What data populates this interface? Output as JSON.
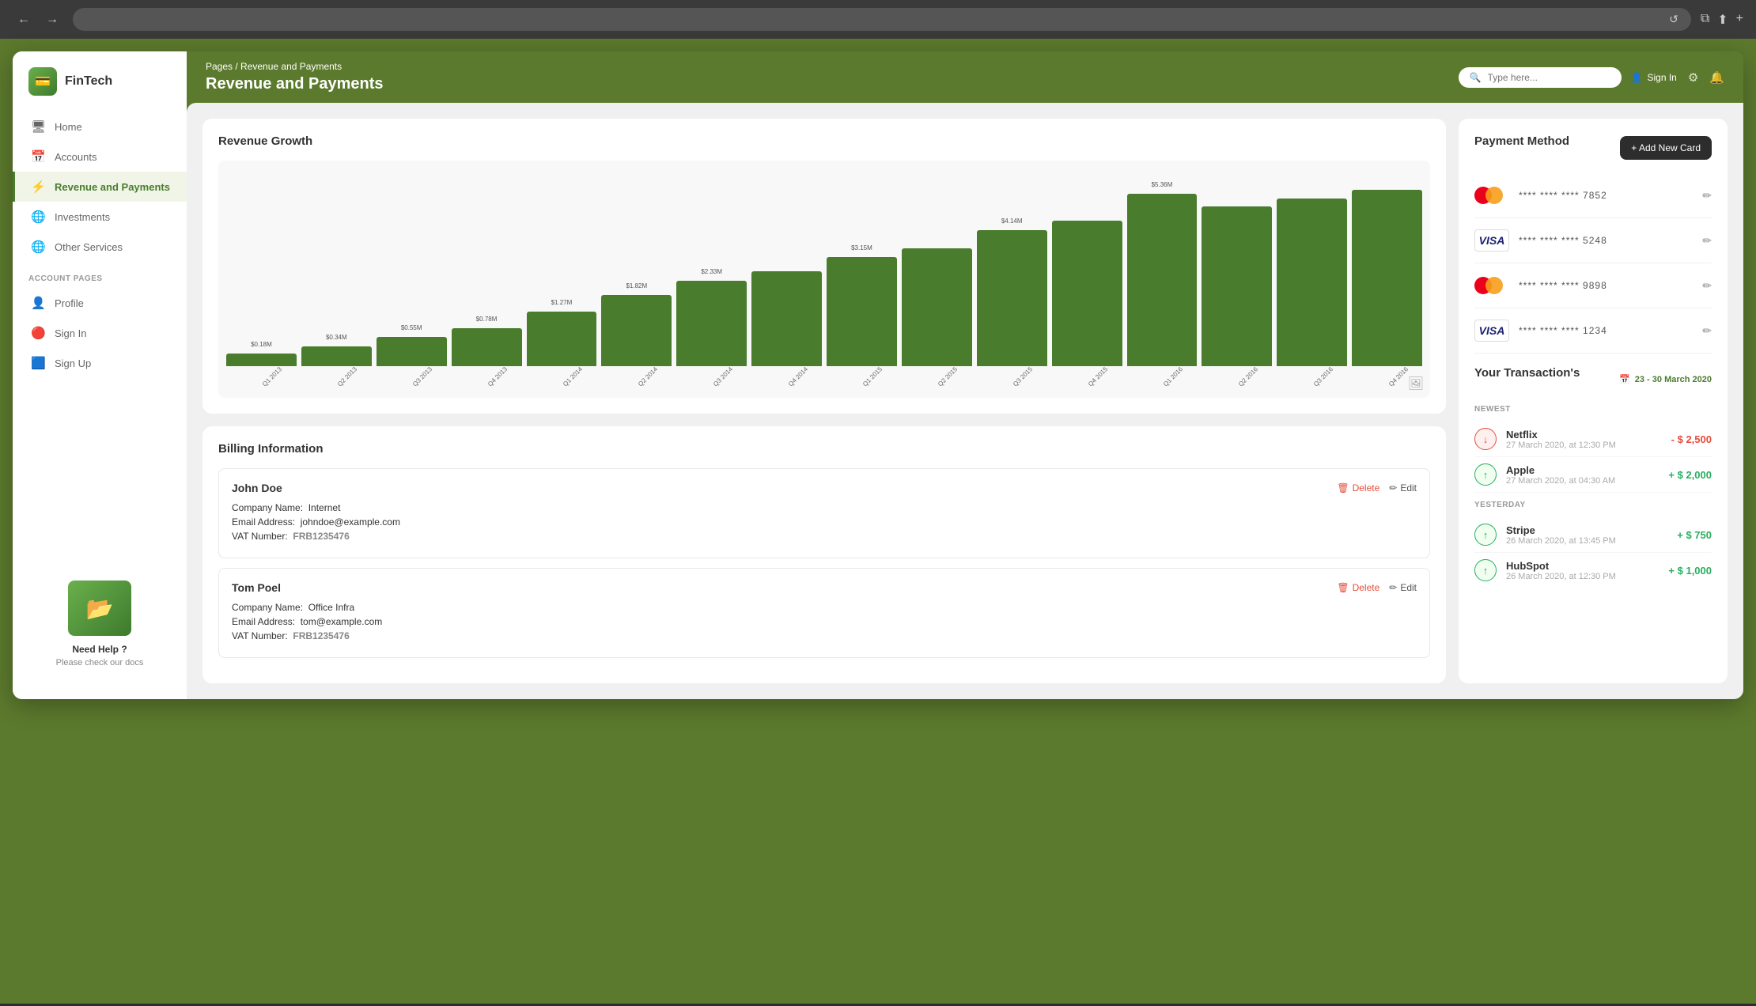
{
  "browser": {
    "back_label": "←",
    "forward_label": "→",
    "reload_label": "↺",
    "address_placeholder": "",
    "action_labels": [
      "⧉",
      "⬆",
      "+"
    ]
  },
  "sidebar": {
    "logo_text": "FinTech",
    "nav_items": [
      {
        "id": "home",
        "label": "Home",
        "icon": "🖥",
        "active": false
      },
      {
        "id": "accounts",
        "label": "Accounts",
        "icon": "📅",
        "active": false
      },
      {
        "id": "revenue",
        "label": "Revenue and Payments",
        "icon": "⚡",
        "active": true
      },
      {
        "id": "investments",
        "label": "Investments",
        "icon": "🌐",
        "active": false
      },
      {
        "id": "other",
        "label": "Other Services",
        "icon": "🌐",
        "active": false
      }
    ],
    "account_section_label": "ACCOUNT PAGES",
    "account_items": [
      {
        "id": "profile",
        "label": "Profile",
        "icon": "👤",
        "active": false
      },
      {
        "id": "signin",
        "label": "Sign In",
        "icon": "🔴",
        "active": false
      },
      {
        "id": "signup",
        "label": "Sign Up",
        "icon": "🟦",
        "active": false
      }
    ],
    "help": {
      "title": "Need Help ?",
      "subtitle": "Please check our docs"
    }
  },
  "header": {
    "breadcrumb_pages": "Pages",
    "breadcrumb_separator": "/",
    "breadcrumb_current": "Revenue and Payments",
    "page_title": "Revenue and Payments",
    "search_placeholder": "Type here...",
    "sign_in_label": "Sign In",
    "settings_icon": "⚙",
    "notifications_icon": "🔔"
  },
  "revenue_chart": {
    "title": "Revenue Growth",
    "bars": [
      {
        "label": "Q1 2013",
        "value": "$0.18M",
        "height_pct": 7
      },
      {
        "label": "Q2 2013",
        "value": "$0.34M",
        "height_pct": 11
      },
      {
        "label": "Q3 2013",
        "value": "$0.55M",
        "height_pct": 16
      },
      {
        "label": "Q4 2013",
        "value": "$0.78M",
        "height_pct": 21
      },
      {
        "label": "Q1 2014",
        "value": "$1.27M",
        "height_pct": 30
      },
      {
        "label": "Q2 2014",
        "value": "$1.82M",
        "height_pct": 39
      },
      {
        "label": "Q3 2014",
        "value": "$2.33M",
        "height_pct": 47
      },
      {
        "label": "Q4 2014",
        "value": "",
        "height_pct": 52
      },
      {
        "label": "Q1 2015",
        "value": "$3.15M",
        "height_pct": 60
      },
      {
        "label": "Q2 2015",
        "value": "",
        "height_pct": 65
      },
      {
        "label": "Q3 2015",
        "value": "$4.14M",
        "height_pct": 75
      },
      {
        "label": "Q4 2015",
        "value": "",
        "height_pct": 80
      },
      {
        "label": "Q1 2016",
        "value": "$5.36M",
        "height_pct": 95
      },
      {
        "label": "Q2 2016",
        "value": "",
        "height_pct": 88
      },
      {
        "label": "Q3 2016",
        "value": "",
        "height_pct": 92
      },
      {
        "label": "Q4 2016",
        "value": "",
        "height_pct": 97
      }
    ]
  },
  "payment_method": {
    "title": "Payment Method",
    "add_button_label": "+ Add New Card",
    "cards": [
      {
        "type": "mastercard",
        "number": "**** **** **** 7852"
      },
      {
        "type": "visa",
        "number": "**** **** **** 5248"
      },
      {
        "type": "mastercard",
        "number": "**** **** **** 9898"
      },
      {
        "type": "visa",
        "number": "**** **** **** 1234"
      }
    ]
  },
  "billing": {
    "title": "Billing Information",
    "entries": [
      {
        "name": "John Doe",
        "company_label": "Company Name:",
        "company": "Internet",
        "email_label": "Email Address:",
        "email": "johndoe@example.com",
        "vat_label": "VAT Number:",
        "vat": "FRB1235476"
      },
      {
        "name": "Tom Poel",
        "company_label": "Company Name:",
        "company": "Office Infra",
        "email_label": "Email Address:",
        "email": "tom@example.com",
        "vat_label": "VAT Number:",
        "vat": "FRB1235476"
      }
    ],
    "delete_label": "Delete",
    "edit_label": "Edit"
  },
  "transactions": {
    "title": "Your Transaction's",
    "date_range": "23 - 30 March 2020",
    "newest_label": "NEWEST",
    "yesterday_label": "YESTERDAY",
    "items": [
      {
        "name": "Netflix",
        "date": "27 March 2020, at 12:30 PM",
        "amount": "- $ 2,500",
        "direction": "down",
        "section": "newest"
      },
      {
        "name": "Apple",
        "date": "27 March 2020, at 04:30 AM",
        "amount": "+ $ 2,000",
        "direction": "up",
        "section": "newest"
      },
      {
        "name": "Stripe",
        "date": "26 March 2020, at 13:45 PM",
        "amount": "+ $ 750",
        "direction": "up",
        "section": "yesterday"
      },
      {
        "name": "HubSpot",
        "date": "26 March 2020, at 12:30 PM",
        "amount": "+ $ 1,000",
        "direction": "up",
        "section": "yesterday"
      }
    ]
  }
}
